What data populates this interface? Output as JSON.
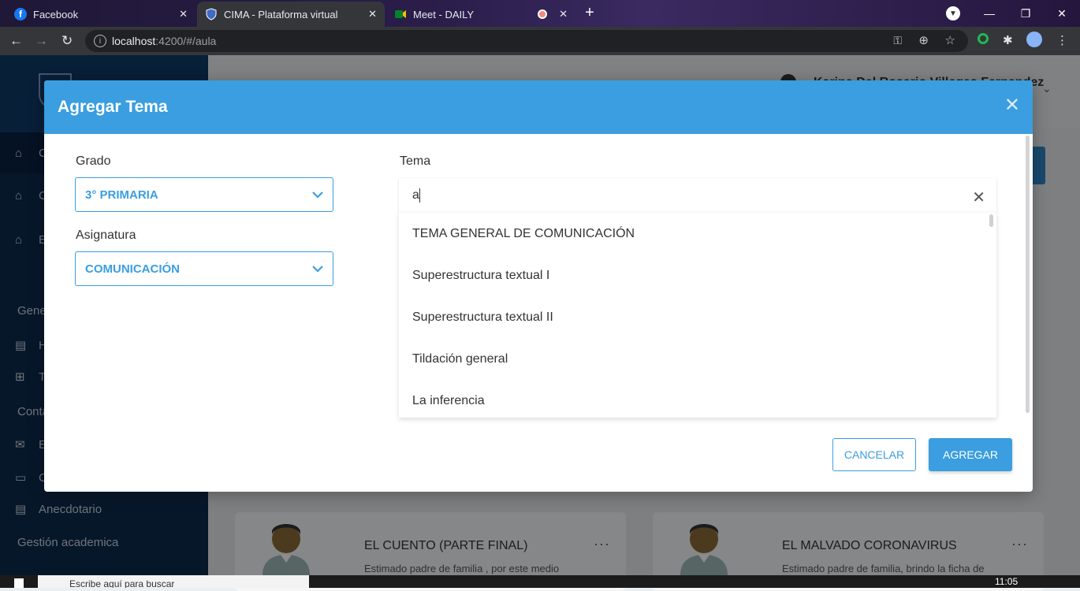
{
  "browser": {
    "tabs": [
      {
        "title": "Facebook",
        "close": "✕",
        "favicon_color": "#1877f2"
      },
      {
        "title": "CIMA - Plataforma virtual",
        "close": "✕",
        "favicon_color": "#3d6bc7"
      },
      {
        "title": "Meet - DAILY",
        "close": "✕",
        "favicon_color": "#00832d"
      }
    ],
    "new_tab": "+",
    "url_host": "localhost",
    "url_path": ":4200/#/aula"
  },
  "sidebar": {
    "items": [
      {
        "label": "C",
        "icon": "graduation-cap-icon"
      },
      {
        "label": "C",
        "icon": "graduation-cap-icon"
      },
      {
        "label": "E",
        "icon": "graduation-cap-icon"
      }
    ],
    "sections": [
      "Gene",
      "Conta",
      "Gestión academica"
    ],
    "sub_items": [
      {
        "label": "H",
        "icon": "document-icon"
      },
      {
        "label": "T",
        "icon": "grid-icon"
      },
      {
        "label": "E",
        "icon": "mail-icon"
      },
      {
        "label": "C",
        "icon": "chat-icon"
      },
      {
        "label": "Anecdotario",
        "icon": "document-icon"
      }
    ]
  },
  "header": {
    "user_name": "Karina Del Rosario Villegas Fernandez"
  },
  "cards": [
    {
      "title": "EL CUENTO (PARTE FINAL)",
      "text": "Estimado padre de familia , por este medio",
      "menu": "···"
    },
    {
      "title": "EL MALVADO CORONAVIRUS",
      "text": "Estimado padre de familia, brindo la ficha de",
      "menu": "···"
    }
  ],
  "modal": {
    "title": "Agregar Tema",
    "close": "✕",
    "grado_label": "Grado",
    "grado_value": "3° PRIMARIA",
    "asignatura_label": "Asignatura",
    "asignatura_value": "COMUNICACIÓN",
    "tema_label": "Tema",
    "tema_input": "a",
    "tema_clear": "✕",
    "options": [
      "TEMA GENERAL DE COMUNICACIÓN",
      "Superestructura textual I",
      "Superestructura textual II",
      "Tildación general",
      "La inferencia"
    ],
    "cancel_label": "CANCELAR",
    "add_label": "AGREGAR"
  },
  "taskbar": {
    "search_placeholder": "Escribe aquí para buscar",
    "time": "11:05"
  },
  "colors": {
    "accent": "#3a9ee0",
    "sidebar": "#0d2b4d"
  }
}
